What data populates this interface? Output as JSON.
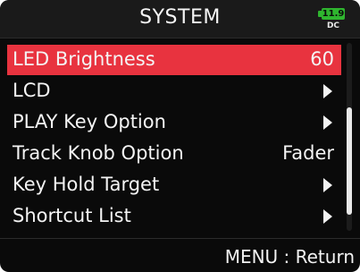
{
  "header": {
    "title": "SYSTEM",
    "battery_level": "11.9",
    "power_source": "DC",
    "battery_color": "#2fb52f"
  },
  "menu": {
    "selected_color": "#e8333f",
    "items": [
      {
        "label": "LED Brightness",
        "value": "60",
        "has_submenu": false,
        "selected": true
      },
      {
        "label": "LCD",
        "value": "",
        "has_submenu": true,
        "selected": false
      },
      {
        "label": "PLAY Key Option",
        "value": "",
        "has_submenu": true,
        "selected": false
      },
      {
        "label": "Track Knob Option",
        "value": "Fader",
        "has_submenu": false,
        "selected": false
      },
      {
        "label": "Key Hold Target",
        "value": "",
        "has_submenu": true,
        "selected": false
      },
      {
        "label": "Shortcut List",
        "value": "",
        "has_submenu": true,
        "selected": false
      }
    ]
  },
  "footer": {
    "hint": "MENU : Return"
  }
}
